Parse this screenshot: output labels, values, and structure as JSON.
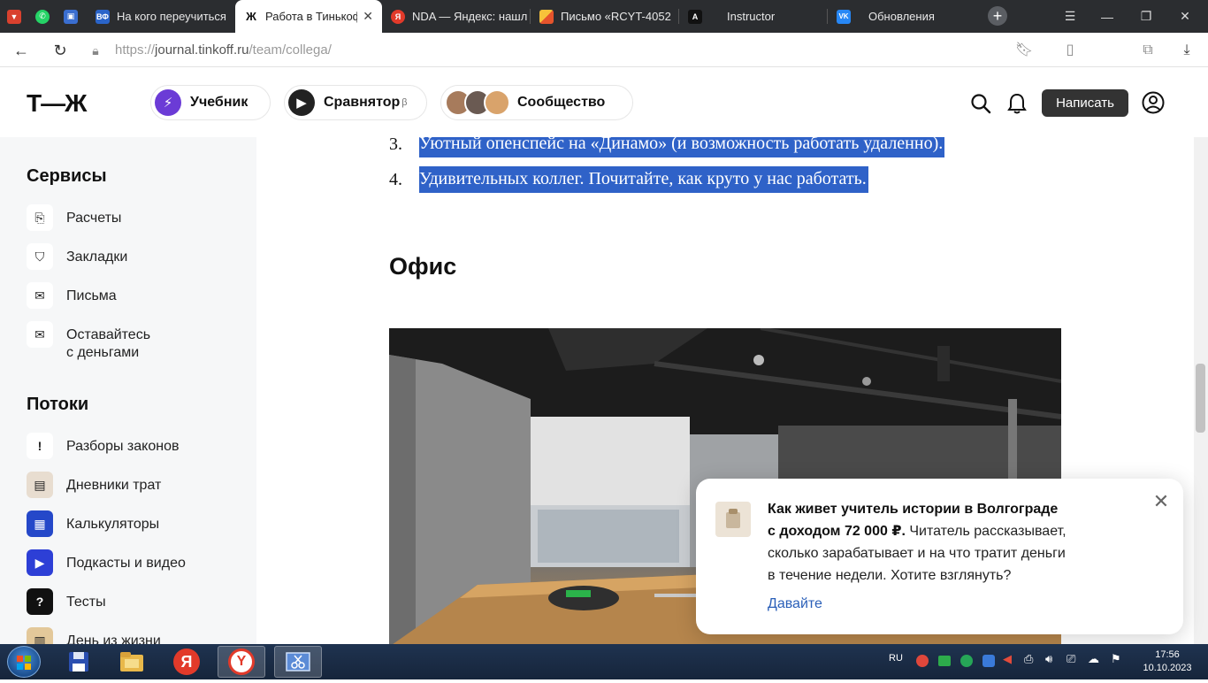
{
  "browser": {
    "tabs": [
      {
        "label": "",
        "icon": "app-icon"
      },
      {
        "label": "",
        "icon": "whatsapp-icon"
      },
      {
        "label": "",
        "icon": "bookmark-app-icon"
      },
      {
        "label": "На кого переучиться",
        "icon": "vf-icon",
        "icon_text": "ВФ"
      },
      {
        "label": "Работа в Тинькофф",
        "icon": "tj-icon",
        "icon_text": "Ж",
        "active": true
      },
      {
        "label": "NDA — Яндекс: нашл",
        "icon": "yandex-icon",
        "icon_text": "Я"
      },
      {
        "label": "Письмо «RCYT-4052",
        "icon": "mail-icon"
      },
      {
        "label": "Instructor",
        "icon": "instructor-icon",
        "icon_text": "A"
      },
      {
        "label": "Обновления",
        "icon": "vk-icon",
        "icon_text": "VK"
      }
    ],
    "close_glyph": "✕",
    "new_tab_glyph": "+",
    "url": {
      "scheme": "https://",
      "host": "journal.tinkoff.ru",
      "path": "/team/collega/"
    }
  },
  "site": {
    "logo": "Т—Ж",
    "nav": {
      "textbook": "Учебник",
      "comparator": "Сравнятор",
      "comparator_sup": "β",
      "community": "Сообщество"
    },
    "write_button": "Написать"
  },
  "sidebar": {
    "services_heading": "Сервисы",
    "services": [
      {
        "label": "Расчеты",
        "icon": "calc-doc-icon"
      },
      {
        "label": "Закладки",
        "icon": "bookmark-icon"
      },
      {
        "label": "Письма",
        "icon": "envelope-icon"
      },
      {
        "label": "Оставайтесь\nс деньгами",
        "line1": "Оставайтесь",
        "line2": "с деньгами",
        "icon": "money-mail-icon"
      }
    ],
    "streams_heading": "Потоки",
    "streams": [
      {
        "label": "Разборы законов",
        "icon": "speech-exclaim-icon"
      },
      {
        "label": "Дневники трат",
        "icon": "diary-icon"
      },
      {
        "label": "Калькуляторы",
        "icon": "calculator-icon"
      },
      {
        "label": "Подкасты и видео",
        "icon": "play-icon"
      },
      {
        "label": "Тесты",
        "icon": "question-icon"
      },
      {
        "label": "День из жизни",
        "icon": "day-icon"
      }
    ]
  },
  "article": {
    "list": [
      {
        "num": "3.",
        "text": "Уютный опенспейс на «Динамо» (и возможность работать удаленно)."
      },
      {
        "num": "4.",
        "text": "Удивительных коллег. Почитайте, как круто у нас работать."
      }
    ],
    "section_heading": "Офис"
  },
  "popup": {
    "title_line1": "Как живет учитель истории в Волгограде",
    "title_line2": "с доходом 72 000 ₽.",
    "body_line1": " Читатель рассказывает,",
    "body_line2": "сколько зарабатывает и на что тратит деньги",
    "body_line3": "в течение недели. Хотите взглянуть?",
    "cta": "Давайте",
    "close": "✕"
  },
  "taskbar": {
    "lang": "RU",
    "time": "17:56",
    "date": "10.10.2023"
  },
  "colors": {
    "highlight": "#2f62c8",
    "tabbar": "#2b2d30",
    "link": "#2a5fb8",
    "write_button": "#333333"
  }
}
